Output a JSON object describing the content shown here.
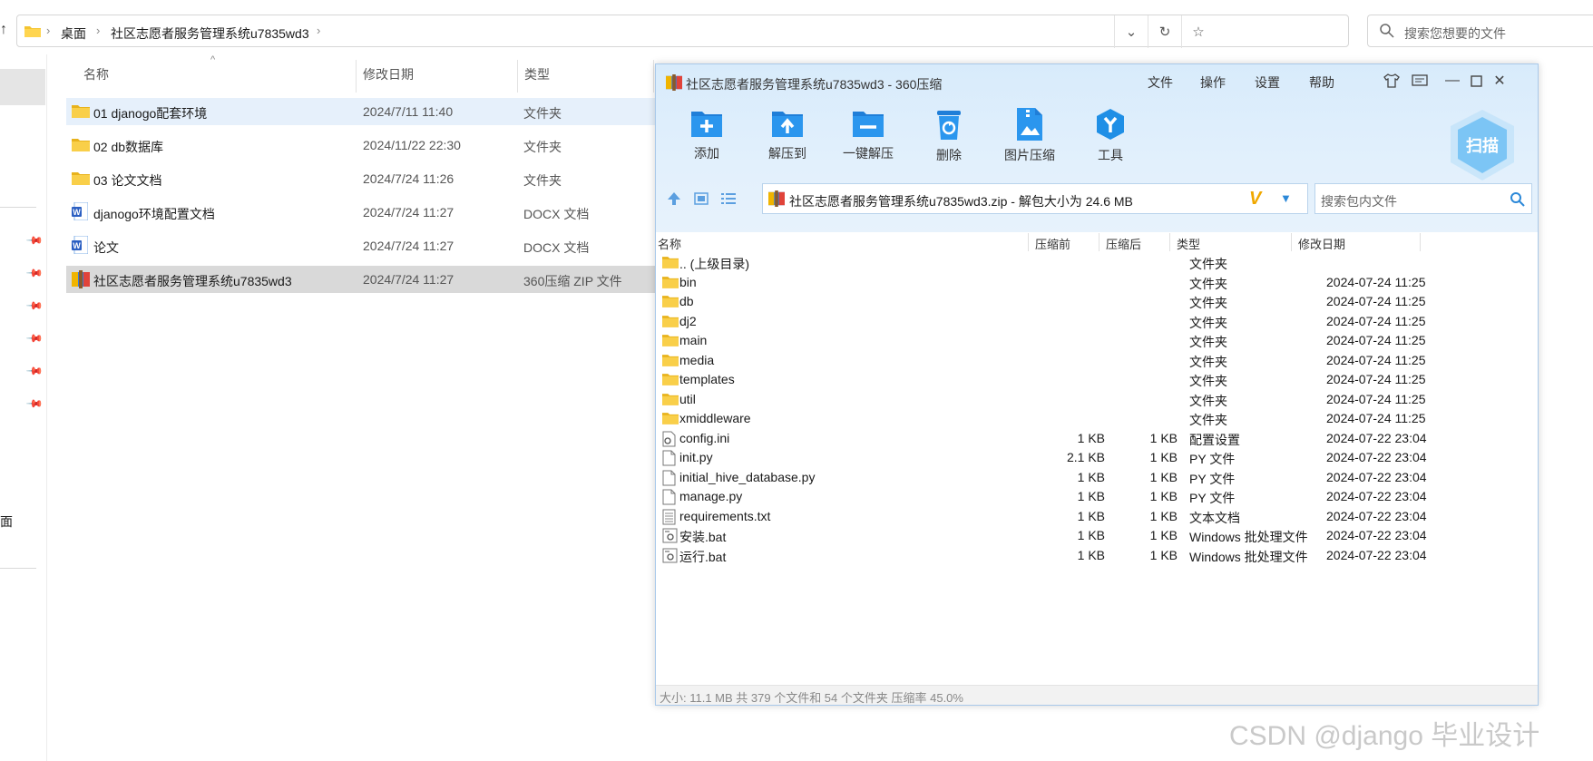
{
  "explorer": {
    "address": {
      "crumbs": [
        "桌面",
        "社区志愿者服务管理系统u7835wd3"
      ]
    },
    "search_placeholder": "搜索您想要的文件",
    "nav_partial_label": "面",
    "columns": {
      "name": "名称",
      "date": "修改日期",
      "type": "类型"
    },
    "files": [
      {
        "name": "01 djanogo配套环境",
        "date": "2024/7/11 11:40",
        "type": "文件夹",
        "icon": "folder-icon"
      },
      {
        "name": "02 db数据库",
        "date": "2024/11/22 22:30",
        "type": "文件夹",
        "icon": "folder-icon"
      },
      {
        "name": "03 论文文档",
        "date": "2024/7/24 11:26",
        "type": "文件夹",
        "icon": "folder-icon"
      },
      {
        "name": "djanogo环境配置文档",
        "date": "2024/7/24 11:27",
        "type": "DOCX 文档",
        "icon": "word-doc-icon"
      },
      {
        "name": "论文",
        "date": "2024/7/24 11:27",
        "type": "DOCX 文档",
        "icon": "word-doc-icon"
      },
      {
        "name": "社区志愿者服务管理系统u7835wd3",
        "date": "2024/7/24 11:27",
        "type": "360压缩 ZIP 文件",
        "icon": "zip-archive-icon"
      }
    ]
  },
  "zip": {
    "title": "社区志愿者服务管理系统u7835wd3 - 360压缩",
    "menu": [
      "文件",
      "操作",
      "设置",
      "帮助"
    ],
    "toolbar": [
      {
        "label": "添加",
        "icon": "add-icon"
      },
      {
        "label": "解压到",
        "icon": "extract-to-icon"
      },
      {
        "label": "一键解压",
        "icon": "one-click-extract-icon"
      },
      {
        "label": "删除",
        "icon": "delete-icon"
      },
      {
        "label": "图片压缩",
        "icon": "image-compress-icon"
      },
      {
        "label": "工具",
        "icon": "tools-icon"
      }
    ],
    "scan_label": "扫描",
    "path_text": "社区志愿者服务管理系统u7835wd3.zip - 解包大小为 24.6 MB",
    "search_placeholder": "搜索包内文件",
    "columns": {
      "name": "名称",
      "before": "压缩前",
      "after": "压缩后",
      "type": "类型",
      "date": "修改日期"
    },
    "rows": [
      {
        "name": ".. (上级目录)",
        "before": "",
        "after": "",
        "type": "文件夹",
        "date": "",
        "icon": "folder-icon"
      },
      {
        "name": "bin",
        "before": "",
        "after": "",
        "type": "文件夹",
        "date": "2024-07-24 11:25",
        "icon": "folder-icon"
      },
      {
        "name": "db",
        "before": "",
        "after": "",
        "type": "文件夹",
        "date": "2024-07-24 11:25",
        "icon": "folder-icon"
      },
      {
        "name": "dj2",
        "before": "",
        "after": "",
        "type": "文件夹",
        "date": "2024-07-24 11:25",
        "icon": "folder-icon"
      },
      {
        "name": "main",
        "before": "",
        "after": "",
        "type": "文件夹",
        "date": "2024-07-24 11:25",
        "icon": "folder-icon"
      },
      {
        "name": "media",
        "before": "",
        "after": "",
        "type": "文件夹",
        "date": "2024-07-24 11:25",
        "icon": "folder-icon"
      },
      {
        "name": "templates",
        "before": "",
        "after": "",
        "type": "文件夹",
        "date": "2024-07-24 11:25",
        "icon": "folder-icon"
      },
      {
        "name": "util",
        "before": "",
        "after": "",
        "type": "文件夹",
        "date": "2024-07-24 11:25",
        "icon": "folder-icon"
      },
      {
        "name": "xmiddleware",
        "before": "",
        "after": "",
        "type": "文件夹",
        "date": "2024-07-24 11:25",
        "icon": "folder-icon"
      },
      {
        "name": "config.ini",
        "before": "1 KB",
        "after": "1 KB",
        "type": "配置设置",
        "date": "2024-07-22 23:04",
        "icon": "config-file-icon"
      },
      {
        "name": "init.py",
        "before": "2.1 KB",
        "after": "1 KB",
        "type": "PY 文件",
        "date": "2024-07-22 23:04",
        "icon": "file-icon"
      },
      {
        "name": "initial_hive_database.py",
        "before": "1 KB",
        "after": "1 KB",
        "type": "PY 文件",
        "date": "2024-07-22 23:04",
        "icon": "file-icon"
      },
      {
        "name": "manage.py",
        "before": "1 KB",
        "after": "1 KB",
        "type": "PY 文件",
        "date": "2024-07-22 23:04",
        "icon": "file-icon"
      },
      {
        "name": "requirements.txt",
        "before": "1 KB",
        "after": "1 KB",
        "type": "文本文档",
        "date": "2024-07-22 23:04",
        "icon": "text-file-icon"
      },
      {
        "name": "安装.bat",
        "before": "1 KB",
        "after": "1 KB",
        "type": "Windows 批处理文件",
        "date": "2024-07-22 23:04",
        "icon": "batch-file-icon"
      },
      {
        "name": "运行.bat",
        "before": "1 KB",
        "after": "1 KB",
        "type": "Windows 批处理文件",
        "date": "2024-07-22 23:04",
        "icon": "batch-file-icon"
      }
    ],
    "status": "大小: 11.1 MB 共 379 个文件和 54 个文件夹 压缩率 45.0%"
  },
  "watermark": "CSDN @django 毕业设计",
  "colors": {
    "accent": "#2b88d8",
    "folder": "#f4c430",
    "selection": "#d9d9d9",
    "hover": "#e6f0fb"
  }
}
